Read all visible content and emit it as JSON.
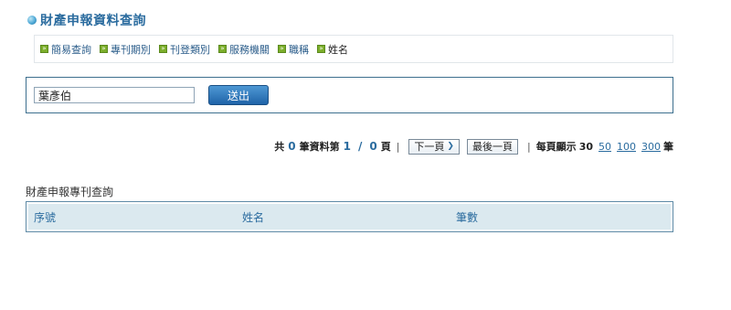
{
  "page": {
    "title": "財產申報資料查詢"
  },
  "nav": {
    "items": [
      {
        "label": "簡易查詢"
      },
      {
        "label": "專刊期別"
      },
      {
        "label": "刊登類別"
      },
      {
        "label": "服務機關"
      },
      {
        "label": "職稱"
      },
      {
        "label": "姓名"
      }
    ]
  },
  "search": {
    "value": "葉彥伯",
    "submit_label": "送出"
  },
  "pager": {
    "total_prefix": "共",
    "total_count": "0",
    "total_suffix": "筆資料第",
    "current_page": "1",
    "slash": "/",
    "total_pages": "0",
    "page_suffix": "頁",
    "sep": "|",
    "next_label": "下一頁",
    "last_label": "最後一頁",
    "per_page_label": "每頁顯示",
    "size_current": "30",
    "size_options": [
      "50",
      "100",
      "300"
    ],
    "size_suffix": "筆"
  },
  "results": {
    "title": "財產申報專刊查詢",
    "columns": [
      "序號",
      "姓名",
      "筆數"
    ]
  },
  "colors": {
    "accent": "#2b6c9f",
    "border": "#3d6f8e",
    "header_bg": "#dbe9ef",
    "nav_icon": "#7cae2b"
  }
}
